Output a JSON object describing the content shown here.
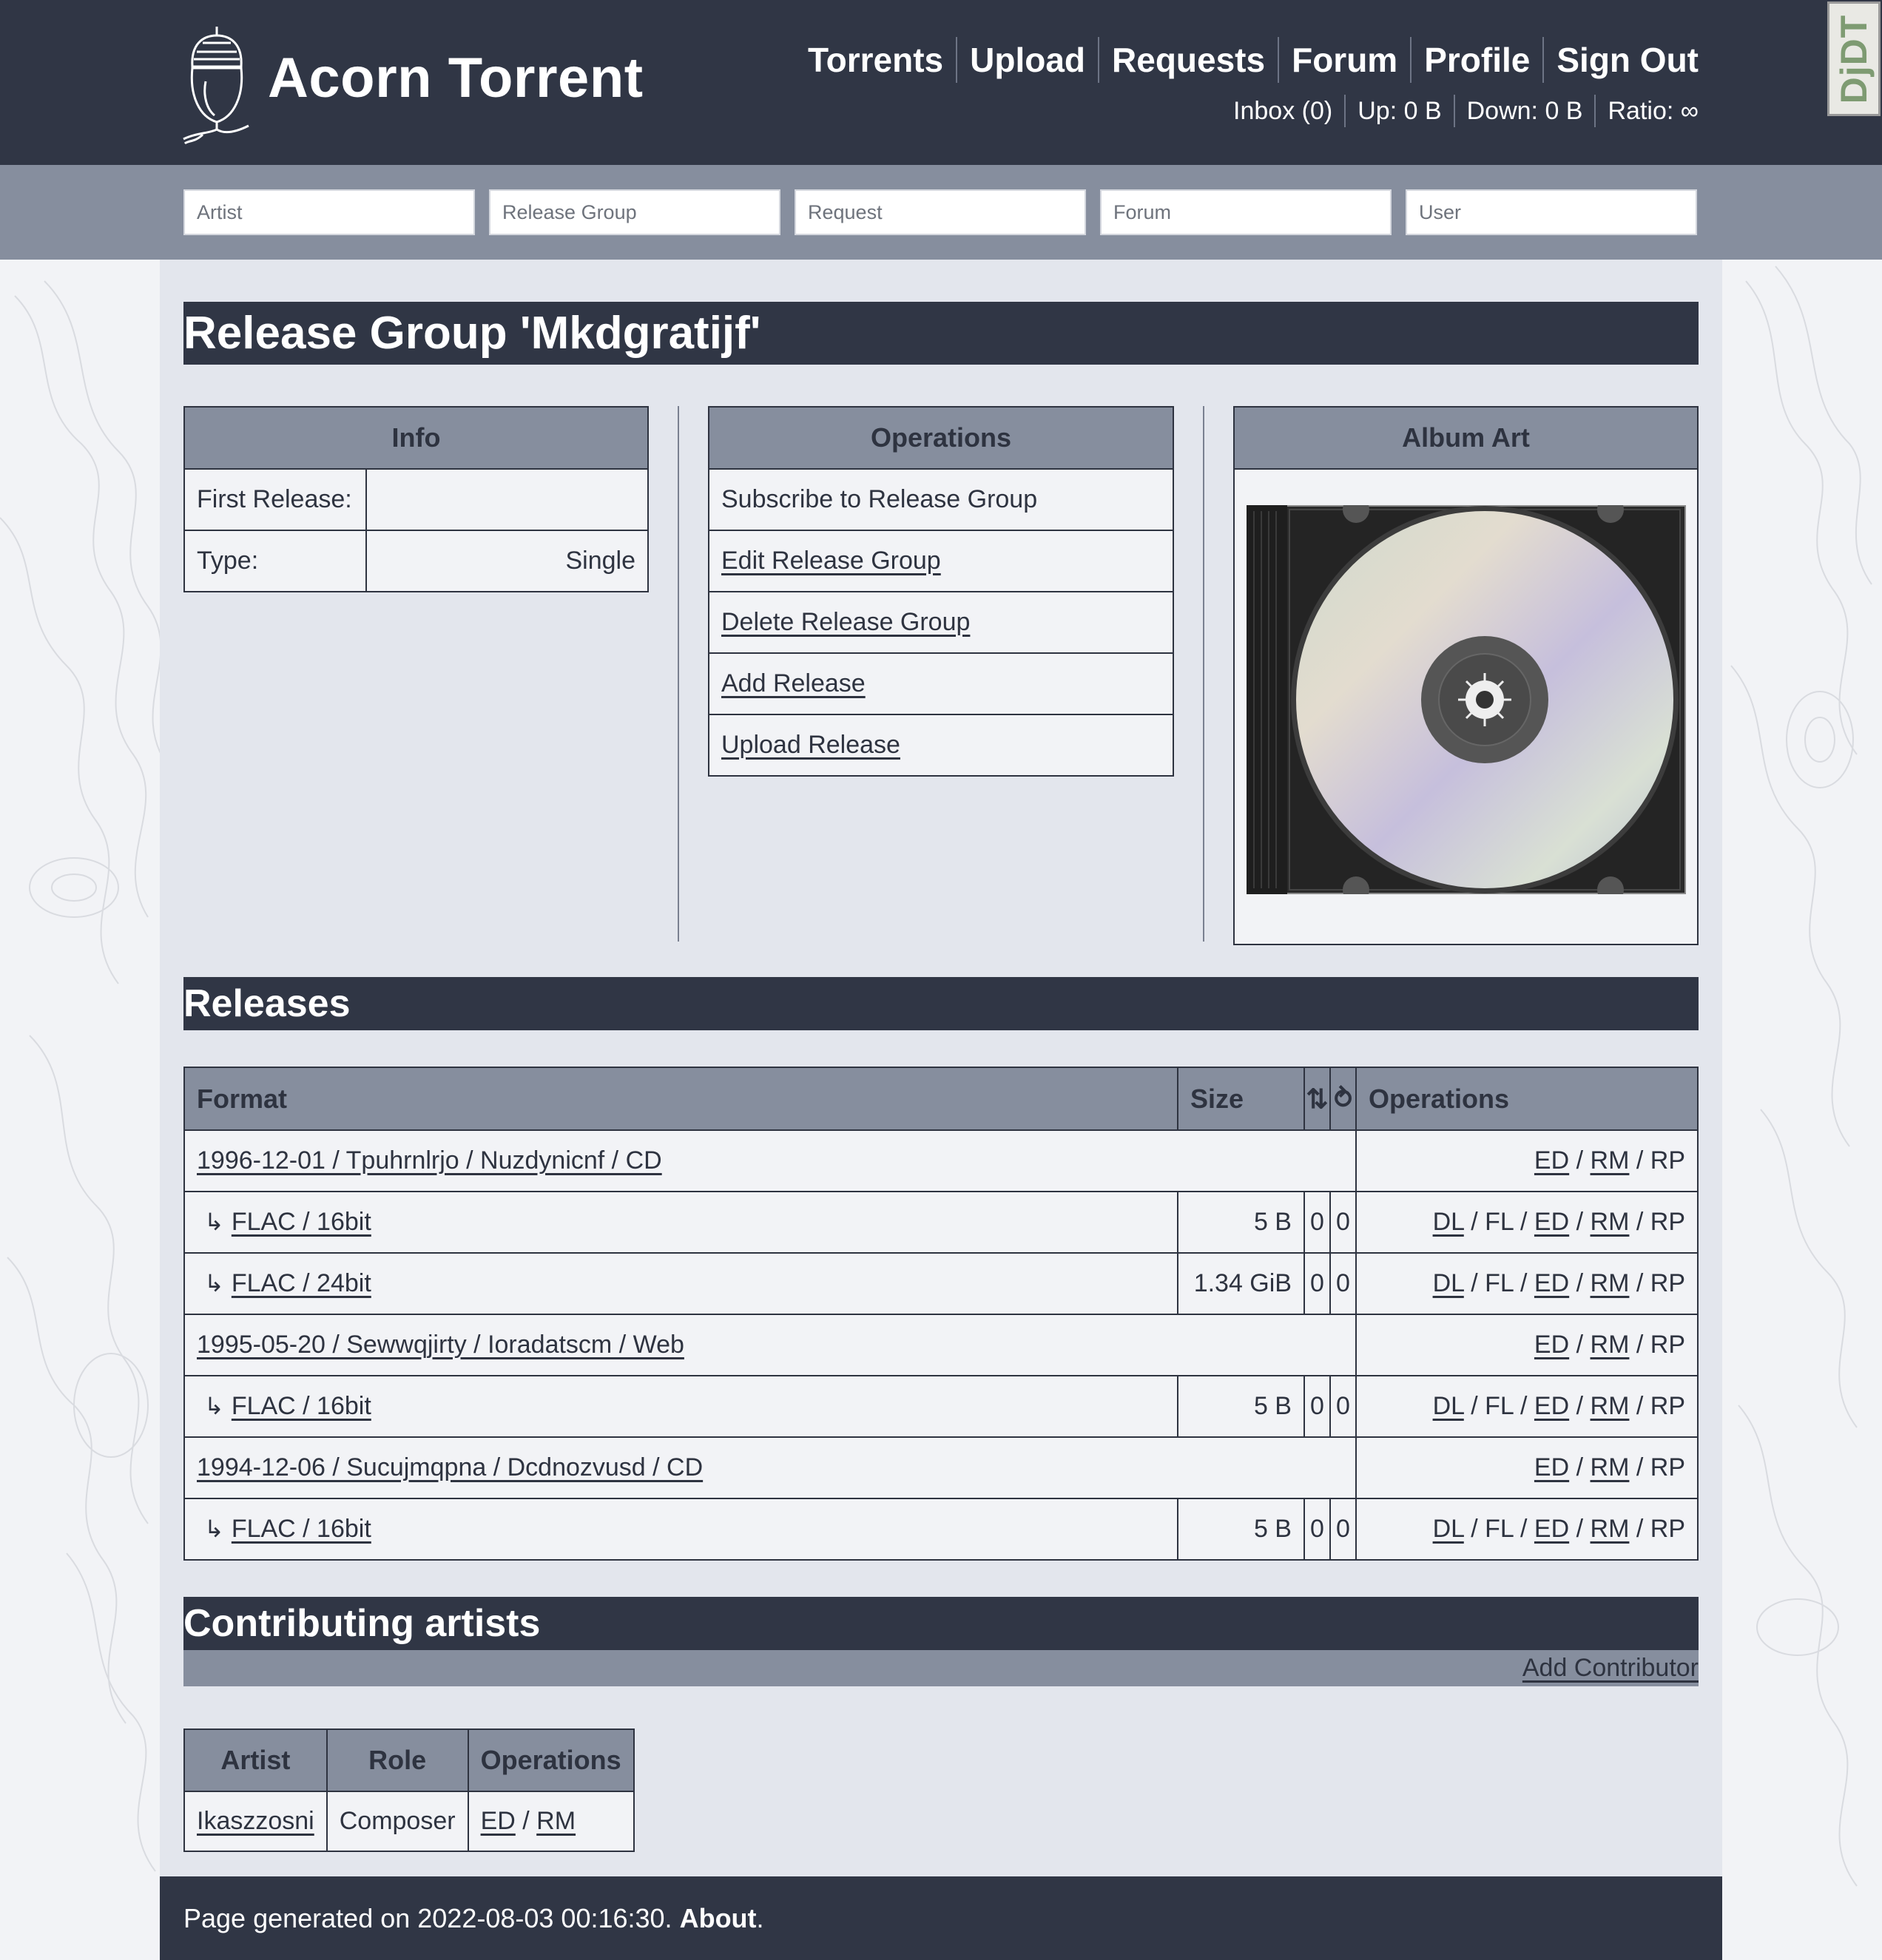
{
  "site": {
    "title": "Acorn Torrent"
  },
  "nav": {
    "torrents": "Torrents",
    "upload": "Upload",
    "requests": "Requests",
    "forum": "Forum",
    "profile": "Profile",
    "sign_out": "Sign Out"
  },
  "stats": {
    "inbox": "Inbox (0)",
    "up": "Up: 0 B",
    "down": "Down: 0 B",
    "ratio": "Ratio: ∞"
  },
  "debug_toolbar": {
    "label": "DjDT"
  },
  "search": {
    "artist": "Artist",
    "release_group": "Release Group",
    "request": "Request",
    "forum": "Forum",
    "user": "User"
  },
  "page": {
    "title": "Release Group 'Mkdgratijf'"
  },
  "info": {
    "header": "Info",
    "first_release_label": "First Release:",
    "first_release_value": "",
    "type_label": "Type:",
    "type_value": "Single"
  },
  "operations": {
    "header": "Operations",
    "subscribe": "Subscribe to Release Group",
    "edit": "Edit Release Group",
    "delete": "Delete Release Group",
    "add_release": "Add Release",
    "upload_release": "Upload Release"
  },
  "album_art": {
    "header": "Album Art"
  },
  "releases": {
    "title": "Releases",
    "columns": {
      "format": "Format",
      "size": "Size",
      "seeders_icon": "⇅",
      "snatched_icon": "⥁",
      "operations": "Operations"
    },
    "arrow": "↳",
    "sep": "/",
    "ops": {
      "dl": "DL",
      "fl": "FL",
      "ed": "ED",
      "rm": "RM",
      "rp": "RP"
    },
    "groups": [
      {
        "label": "1996-12-01 / Tpuhrnlrjo / Nuzdynicnf / CD",
        "files": [
          {
            "format": "FLAC / 16bit",
            "size": "5 B",
            "seeders": "0",
            "snatched": "0"
          },
          {
            "format": "FLAC / 24bit",
            "size": "1.34 GiB",
            "seeders": "0",
            "snatched": "0"
          }
        ]
      },
      {
        "label": "1995-05-20 / Sewwqjirty / Ioradatscm / Web",
        "files": [
          {
            "format": "FLAC / 16bit",
            "size": "5 B",
            "seeders": "0",
            "snatched": "0"
          }
        ]
      },
      {
        "label": "1994-12-06 / Sucujmqpna / Dcdnozvusd / CD",
        "files": [
          {
            "format": "FLAC / 16bit",
            "size": "5 B",
            "seeders": "0",
            "snatched": "0"
          }
        ]
      }
    ]
  },
  "contributing": {
    "title": "Contributing artists",
    "add": "Add Contributor",
    "columns": {
      "artist": "Artist",
      "role": "Role",
      "operations": "Operations"
    },
    "rows": [
      {
        "artist": "Ikaszzosni",
        "role": "Composer",
        "ed": "ED",
        "rm": "RM"
      }
    ]
  },
  "footer": {
    "text": "Page generated on 2022-08-03 00:16:30.",
    "about": "About",
    "period": "."
  }
}
